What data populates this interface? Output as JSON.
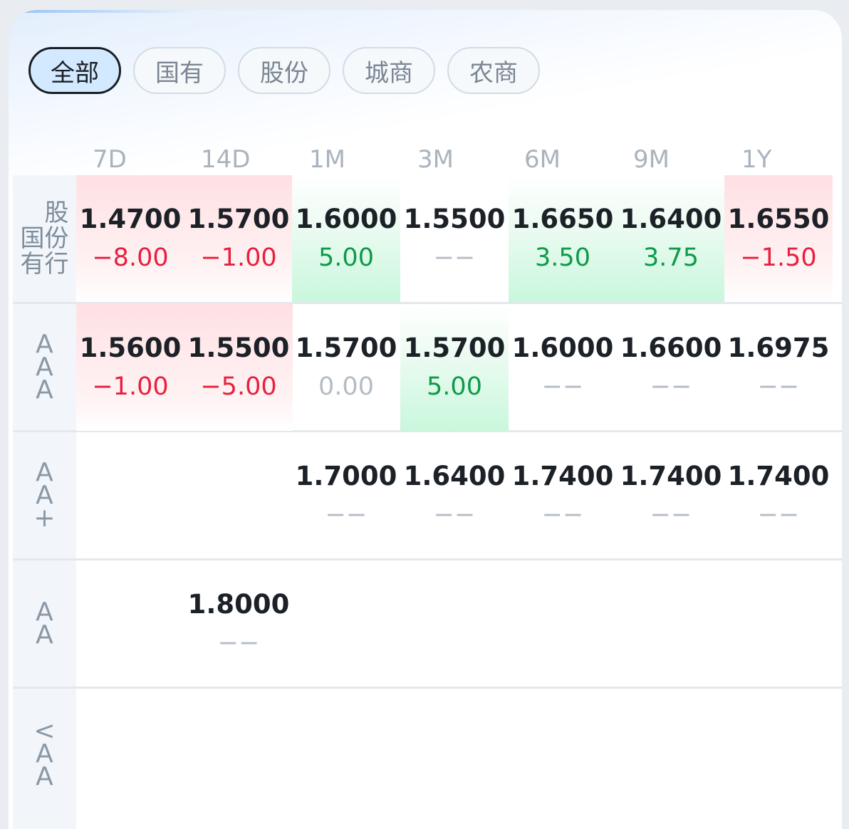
{
  "filter_tabs": [
    {
      "label": "全部",
      "active": true
    },
    {
      "label": "国有",
      "active": false
    },
    {
      "label": "股份",
      "active": false
    },
    {
      "label": "城商",
      "active": false
    },
    {
      "label": "农商",
      "active": false
    }
  ],
  "tenors": [
    "7D",
    "14D",
    "1M",
    "3M",
    "6M",
    "9M",
    "1Y"
  ],
  "colors": {
    "up": "#e8203e",
    "down": "#0e9a49",
    "neutral": "#b4bcc5",
    "active_tab_bg": "#d2e9ff"
  },
  "rows": [
    {
      "label_left": "国有",
      "label_right": "股份行",
      "cells": [
        {
          "rate": "1.4700",
          "change": "−8.00",
          "dir": "up"
        },
        {
          "rate": "1.5700",
          "change": "−1.00",
          "dir": "up"
        },
        {
          "rate": "1.6000",
          "change": "5.00",
          "dir": "down"
        },
        {
          "rate": "1.5500",
          "change": "−−",
          "dir": "none"
        },
        {
          "rate": "1.6650",
          "change": "3.50",
          "dir": "down"
        },
        {
          "rate": "1.6400",
          "change": "3.75",
          "dir": "down"
        },
        {
          "rate": "1.6550",
          "change": "−1.50",
          "dir": "up"
        }
      ]
    },
    {
      "label": "AAA",
      "cells": [
        {
          "rate": "1.5600",
          "change": "−1.00",
          "dir": "up"
        },
        {
          "rate": "1.5500",
          "change": "−5.00",
          "dir": "up"
        },
        {
          "rate": "1.5700",
          "change": "0.00",
          "dir": "flat"
        },
        {
          "rate": "1.5700",
          "change": "5.00",
          "dir": "down"
        },
        {
          "rate": "1.6000",
          "change": "−−",
          "dir": "none"
        },
        {
          "rate": "1.6600",
          "change": "−−",
          "dir": "none"
        },
        {
          "rate": "1.6975",
          "change": "−−",
          "dir": "none"
        }
      ]
    },
    {
      "label": "AA+",
      "cells": [
        {
          "rate": "",
          "change": "",
          "dir": "empty"
        },
        {
          "rate": "",
          "change": "",
          "dir": "empty"
        },
        {
          "rate": "1.7000",
          "change": "−−",
          "dir": "none"
        },
        {
          "rate": "1.6400",
          "change": "−−",
          "dir": "none"
        },
        {
          "rate": "1.7400",
          "change": "−−",
          "dir": "none"
        },
        {
          "rate": "1.7400",
          "change": "−−",
          "dir": "none"
        },
        {
          "rate": "1.7400",
          "change": "−−",
          "dir": "none"
        }
      ]
    },
    {
      "label": "AA",
      "cells": [
        {
          "rate": "",
          "change": "",
          "dir": "empty"
        },
        {
          "rate": "1.8000",
          "change": "−−",
          "dir": "none"
        },
        {
          "rate": "",
          "change": "",
          "dir": "empty"
        },
        {
          "rate": "",
          "change": "",
          "dir": "empty"
        },
        {
          "rate": "",
          "change": "",
          "dir": "empty"
        },
        {
          "rate": "",
          "change": "",
          "dir": "empty"
        },
        {
          "rate": "",
          "change": "",
          "dir": "empty"
        }
      ]
    },
    {
      "label": "<AA",
      "cells": []
    }
  ]
}
